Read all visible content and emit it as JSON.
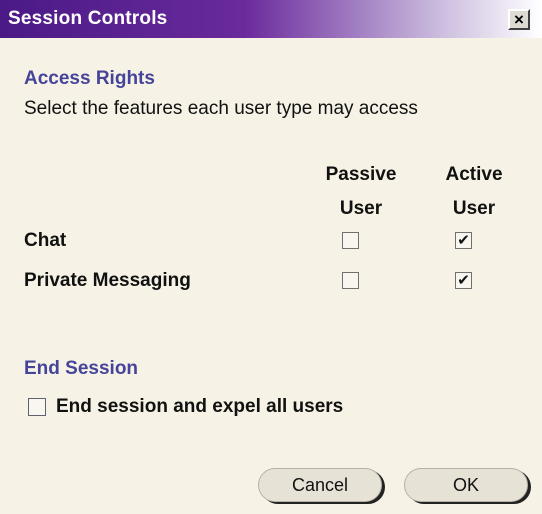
{
  "window": {
    "title": "Session Controls",
    "close_glyph": "×"
  },
  "access": {
    "heading": "Access Rights",
    "description": "Select the features each user type may access",
    "columns": [
      {
        "line1": "Passive",
        "line2": "User"
      },
      {
        "line1": "Active",
        "line2": "User"
      }
    ],
    "rows": [
      {
        "label": "Chat",
        "passive_checked": false,
        "active_checked": true
      },
      {
        "label": "Private Messaging",
        "passive_checked": false,
        "active_checked": true
      }
    ],
    "check_glyph": "✔"
  },
  "end_session": {
    "heading": "End Session",
    "checkbox_label": "End session and expel all users",
    "checked": false
  },
  "buttons": {
    "cancel": "Cancel",
    "ok": "OK"
  },
  "colors": {
    "section_heading": "#46449a",
    "titlebar_start": "#4a1a86",
    "background": "#f6f3e6"
  }
}
